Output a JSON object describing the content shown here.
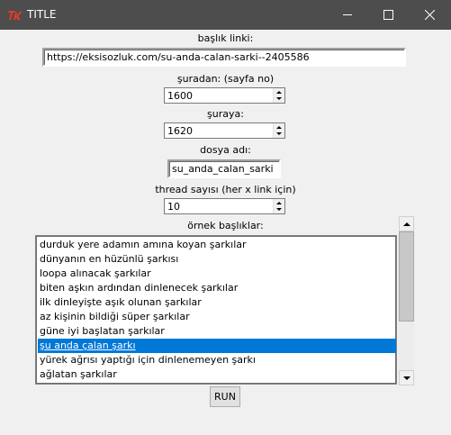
{
  "window": {
    "title": "TITLE",
    "icon": "tk-feather-icon"
  },
  "form": {
    "link_label": "başlık linki:",
    "link_value": "https://eksisozluk.com/su-anda-calan-sarki--2405586",
    "from_label": "şuradan: (sayfa no)",
    "from_value": "1600",
    "to_label": "şuraya:",
    "to_value": "1620",
    "filename_label": "dosya adı:",
    "filename_value": "su_anda_calan_sarki",
    "threads_label": "thread sayısı (her x link için)",
    "threads_value": "10",
    "examples_label": "örnek başlıklar:",
    "run_label": "RUN"
  },
  "examples": [
    {
      "text": "durduk yere adamın amına koyan şarkılar",
      "selected": false
    },
    {
      "text": "dünyanın en hüzünlü şarkısı",
      "selected": false
    },
    {
      "text": "loopa alınacak şarkılar",
      "selected": false
    },
    {
      "text": "biten aşkın ardından dinlenecek şarkılar",
      "selected": false
    },
    {
      "text": "ilk dinleyişte aşık olunan şarkılar",
      "selected": false
    },
    {
      "text": "az kişinin bildiği süper şarkılar",
      "selected": false
    },
    {
      "text": "güne iyi başlatan şarkılar",
      "selected": false
    },
    {
      "text": "şu anda çalan şarkı",
      "selected": true
    },
    {
      "text": "yürek ağrısı yaptığı için dinlenemeyen şarkı",
      "selected": false
    },
    {
      "text": "ağlatan şarkılar",
      "selected": false
    }
  ],
  "colors": {
    "titlebar": "#4d4d4d",
    "selection": "#0078d7",
    "icon_red": "#e8392b"
  }
}
